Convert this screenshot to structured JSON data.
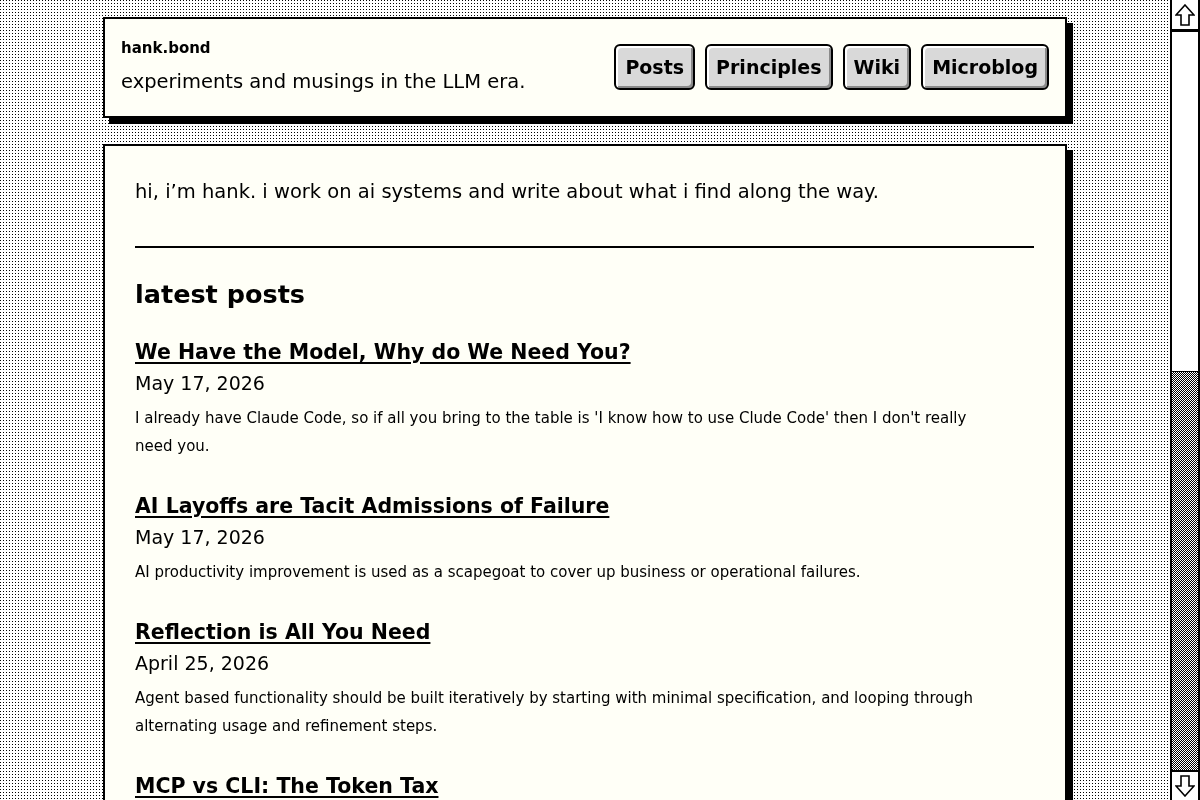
{
  "site": {
    "title": "hank.bond",
    "tagline": "experiments and musings in the LLM era."
  },
  "nav": [
    {
      "label": "Posts"
    },
    {
      "label": "Principles"
    },
    {
      "label": "Wiki"
    },
    {
      "label": "Microblog"
    }
  ],
  "intro": "hi, i’m hank. i work on ai systems and write about what i find along the way.",
  "section_title": "latest posts",
  "posts": [
    {
      "title": "We Have the Model, Why do We Need You?",
      "date": "May 17, 2026",
      "excerpt": "I already have Claude Code, so if all you bring to the table is 'I know how to use Clude Code' then I don't really need you."
    },
    {
      "title": "AI Layoffs are Tacit Admissions of Failure",
      "date": "May 17, 2026",
      "excerpt": "AI productivity improvement is used as a scapegoat to cover up business or operational failures."
    },
    {
      "title": "Reflection is All You Need",
      "date": "April 25, 2026",
      "excerpt": "Agent based functionality should be built iteratively by starting with minimal specification, and looping through alternating usage and refinement steps."
    },
    {
      "title": "MCP vs CLI: The Token Tax"
    }
  ]
}
